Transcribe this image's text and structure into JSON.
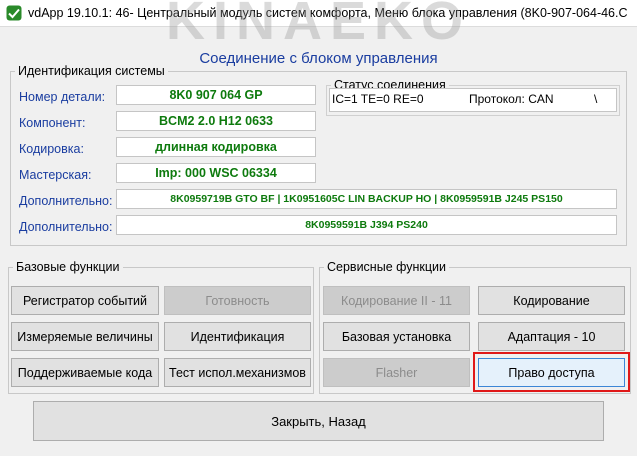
{
  "window": {
    "title": "vdApp 19.10.1: 46- Центральный модуль систем комфорта,  Меню блока управления (8K0-907-064-46.C...",
    "watermark": "KINAEKO"
  },
  "dialog": {
    "title": "Соединение с блоком управления"
  },
  "identification": {
    "legend": "Идентификация системы",
    "part_number": {
      "label": "Номер детали:",
      "value": "8K0 907 064 GP"
    },
    "component": {
      "label": "Компонент:",
      "value": "BCM2 2.0     H12 0633"
    },
    "coding": {
      "label": "Кодировка:",
      "value": "длинная кодировка"
    },
    "workshop": {
      "label": "Мастерская:",
      "value": "Imp: 000     WSC 06334"
    },
    "extra1": {
      "label": "Дополнительно:",
      "value": "8K0959719B GTO BF  |  1K0951605C LIN BACKUP HO  |  8K0959591B J245 PS150"
    },
    "extra2": {
      "label": "Дополнительно:",
      "value": "8K0959591B J394 PS240"
    }
  },
  "connection_status": {
    "legend": "Статус соединения",
    "counters": "IC=1  TE=0   RE=0",
    "protocol": "Протокол: CAN",
    "indicator": "\\"
  },
  "basic_functions": {
    "legend": "Базовые функции",
    "event_log": "Регистратор событий",
    "readiness": "Готовность",
    "measured_values": "Измеряемые величины",
    "identification": "Идентификация",
    "supported_codes": "Поддерживаемые кода",
    "actuator_test": "Тест испол.механизмов"
  },
  "service_functions": {
    "legend": "Сервисные функции",
    "coding_ii": "Кодирование II - 11",
    "coding": "Кодирование",
    "basic_setting": "Базовая установка",
    "adaptation": "Адаптация - 10",
    "flasher": "Flasher",
    "access_rights": "Право доступа"
  },
  "footer": {
    "close": "Закрыть, Назад"
  },
  "colors": {
    "label_blue": "#1a3da0",
    "value_green": "#0d7a0d",
    "highlight_red": "#e01818",
    "focus_blue": "#3c86d6"
  }
}
